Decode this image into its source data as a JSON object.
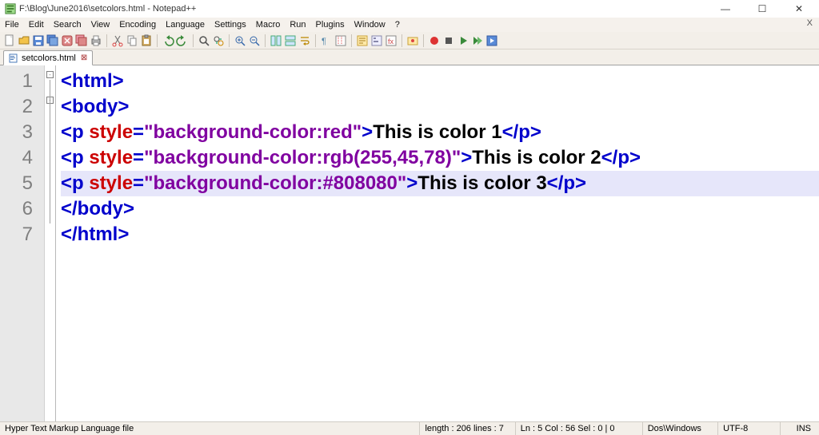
{
  "title": "F:\\Blog\\June2016\\setcolors.html - Notepad++",
  "menu": [
    "File",
    "Edit",
    "Search",
    "View",
    "Encoding",
    "Language",
    "Settings",
    "Macro",
    "Run",
    "Plugins",
    "Window",
    "?"
  ],
  "tab": {
    "name": "setcolors.html"
  },
  "lines": {
    "l1": {
      "open": "<html>"
    },
    "l2": {
      "open": "<body>"
    },
    "l3": {
      "open": "<p ",
      "attr": "style",
      "eq": "=",
      "str": "\"background-color:red\"",
      "close1": ">",
      "txt": "This is color 1",
      "close2": "</p>"
    },
    "l4": {
      "open": "<p ",
      "attr": "style",
      "eq": "=",
      "str": "\"background-color:rgb(255,45,78)\"",
      "close1": ">",
      "txt": "This is color 2",
      "close2": "</p>"
    },
    "l5": {
      "open": "<p ",
      "attr": "style",
      "eq": "=",
      "str": "\"background-color:#808080\"",
      "close1": ">",
      "txt": "This is color 3",
      "close2": "</p>"
    },
    "l6": {
      "open": "</body>"
    },
    "l7": {
      "open": "</html>"
    }
  },
  "gutter": [
    "1",
    "2",
    "3",
    "4",
    "5",
    "6",
    "7"
  ],
  "status": {
    "type": "Hyper Text Markup Language file",
    "length": "length : 206     lines : 7",
    "pos": "Ln : 5    Col : 56    Sel : 0 | 0",
    "enc": "Dos\\Windows",
    "cs": "UTF-8",
    "ins": "INS"
  }
}
